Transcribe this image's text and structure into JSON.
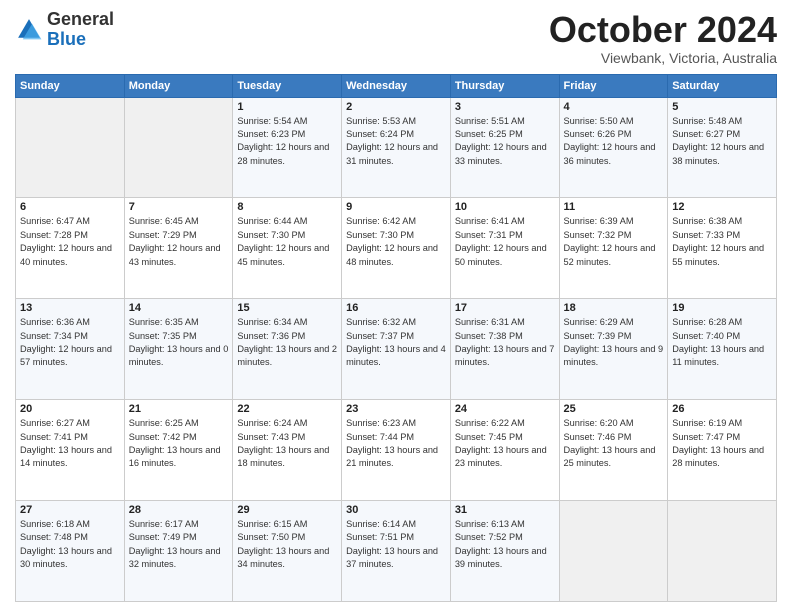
{
  "header": {
    "logo_general": "General",
    "logo_blue": "Blue",
    "month": "October 2024",
    "location": "Viewbank, Victoria, Australia"
  },
  "weekdays": [
    "Sunday",
    "Monday",
    "Tuesday",
    "Wednesday",
    "Thursday",
    "Friday",
    "Saturday"
  ],
  "weeks": [
    [
      {
        "day": "",
        "sunrise": "",
        "sunset": "",
        "daylight": ""
      },
      {
        "day": "",
        "sunrise": "",
        "sunset": "",
        "daylight": ""
      },
      {
        "day": "1",
        "sunrise": "Sunrise: 5:54 AM",
        "sunset": "Sunset: 6:23 PM",
        "daylight": "Daylight: 12 hours and 28 minutes."
      },
      {
        "day": "2",
        "sunrise": "Sunrise: 5:53 AM",
        "sunset": "Sunset: 6:24 PM",
        "daylight": "Daylight: 12 hours and 31 minutes."
      },
      {
        "day": "3",
        "sunrise": "Sunrise: 5:51 AM",
        "sunset": "Sunset: 6:25 PM",
        "daylight": "Daylight: 12 hours and 33 minutes."
      },
      {
        "day": "4",
        "sunrise": "Sunrise: 5:50 AM",
        "sunset": "Sunset: 6:26 PM",
        "daylight": "Daylight: 12 hours and 36 minutes."
      },
      {
        "day": "5",
        "sunrise": "Sunrise: 5:48 AM",
        "sunset": "Sunset: 6:27 PM",
        "daylight": "Daylight: 12 hours and 38 minutes."
      }
    ],
    [
      {
        "day": "6",
        "sunrise": "Sunrise: 6:47 AM",
        "sunset": "Sunset: 7:28 PM",
        "daylight": "Daylight: 12 hours and 40 minutes."
      },
      {
        "day": "7",
        "sunrise": "Sunrise: 6:45 AM",
        "sunset": "Sunset: 7:29 PM",
        "daylight": "Daylight: 12 hours and 43 minutes."
      },
      {
        "day": "8",
        "sunrise": "Sunrise: 6:44 AM",
        "sunset": "Sunset: 7:30 PM",
        "daylight": "Daylight: 12 hours and 45 minutes."
      },
      {
        "day": "9",
        "sunrise": "Sunrise: 6:42 AM",
        "sunset": "Sunset: 7:30 PM",
        "daylight": "Daylight: 12 hours and 48 minutes."
      },
      {
        "day": "10",
        "sunrise": "Sunrise: 6:41 AM",
        "sunset": "Sunset: 7:31 PM",
        "daylight": "Daylight: 12 hours and 50 minutes."
      },
      {
        "day": "11",
        "sunrise": "Sunrise: 6:39 AM",
        "sunset": "Sunset: 7:32 PM",
        "daylight": "Daylight: 12 hours and 52 minutes."
      },
      {
        "day": "12",
        "sunrise": "Sunrise: 6:38 AM",
        "sunset": "Sunset: 7:33 PM",
        "daylight": "Daylight: 12 hours and 55 minutes."
      }
    ],
    [
      {
        "day": "13",
        "sunrise": "Sunrise: 6:36 AM",
        "sunset": "Sunset: 7:34 PM",
        "daylight": "Daylight: 12 hours and 57 minutes."
      },
      {
        "day": "14",
        "sunrise": "Sunrise: 6:35 AM",
        "sunset": "Sunset: 7:35 PM",
        "daylight": "Daylight: 13 hours and 0 minutes."
      },
      {
        "day": "15",
        "sunrise": "Sunrise: 6:34 AM",
        "sunset": "Sunset: 7:36 PM",
        "daylight": "Daylight: 13 hours and 2 minutes."
      },
      {
        "day": "16",
        "sunrise": "Sunrise: 6:32 AM",
        "sunset": "Sunset: 7:37 PM",
        "daylight": "Daylight: 13 hours and 4 minutes."
      },
      {
        "day": "17",
        "sunrise": "Sunrise: 6:31 AM",
        "sunset": "Sunset: 7:38 PM",
        "daylight": "Daylight: 13 hours and 7 minutes."
      },
      {
        "day": "18",
        "sunrise": "Sunrise: 6:29 AM",
        "sunset": "Sunset: 7:39 PM",
        "daylight": "Daylight: 13 hours and 9 minutes."
      },
      {
        "day": "19",
        "sunrise": "Sunrise: 6:28 AM",
        "sunset": "Sunset: 7:40 PM",
        "daylight": "Daylight: 13 hours and 11 minutes."
      }
    ],
    [
      {
        "day": "20",
        "sunrise": "Sunrise: 6:27 AM",
        "sunset": "Sunset: 7:41 PM",
        "daylight": "Daylight: 13 hours and 14 minutes."
      },
      {
        "day": "21",
        "sunrise": "Sunrise: 6:25 AM",
        "sunset": "Sunset: 7:42 PM",
        "daylight": "Daylight: 13 hours and 16 minutes."
      },
      {
        "day": "22",
        "sunrise": "Sunrise: 6:24 AM",
        "sunset": "Sunset: 7:43 PM",
        "daylight": "Daylight: 13 hours and 18 minutes."
      },
      {
        "day": "23",
        "sunrise": "Sunrise: 6:23 AM",
        "sunset": "Sunset: 7:44 PM",
        "daylight": "Daylight: 13 hours and 21 minutes."
      },
      {
        "day": "24",
        "sunrise": "Sunrise: 6:22 AM",
        "sunset": "Sunset: 7:45 PM",
        "daylight": "Daylight: 13 hours and 23 minutes."
      },
      {
        "day": "25",
        "sunrise": "Sunrise: 6:20 AM",
        "sunset": "Sunset: 7:46 PM",
        "daylight": "Daylight: 13 hours and 25 minutes."
      },
      {
        "day": "26",
        "sunrise": "Sunrise: 6:19 AM",
        "sunset": "Sunset: 7:47 PM",
        "daylight": "Daylight: 13 hours and 28 minutes."
      }
    ],
    [
      {
        "day": "27",
        "sunrise": "Sunrise: 6:18 AM",
        "sunset": "Sunset: 7:48 PM",
        "daylight": "Daylight: 13 hours and 30 minutes."
      },
      {
        "day": "28",
        "sunrise": "Sunrise: 6:17 AM",
        "sunset": "Sunset: 7:49 PM",
        "daylight": "Daylight: 13 hours and 32 minutes."
      },
      {
        "day": "29",
        "sunrise": "Sunrise: 6:15 AM",
        "sunset": "Sunset: 7:50 PM",
        "daylight": "Daylight: 13 hours and 34 minutes."
      },
      {
        "day": "30",
        "sunrise": "Sunrise: 6:14 AM",
        "sunset": "Sunset: 7:51 PM",
        "daylight": "Daylight: 13 hours and 37 minutes."
      },
      {
        "day": "31",
        "sunrise": "Sunrise: 6:13 AM",
        "sunset": "Sunset: 7:52 PM",
        "daylight": "Daylight: 13 hours and 39 minutes."
      },
      {
        "day": "",
        "sunrise": "",
        "sunset": "",
        "daylight": ""
      },
      {
        "day": "",
        "sunrise": "",
        "sunset": "",
        "daylight": ""
      }
    ]
  ]
}
